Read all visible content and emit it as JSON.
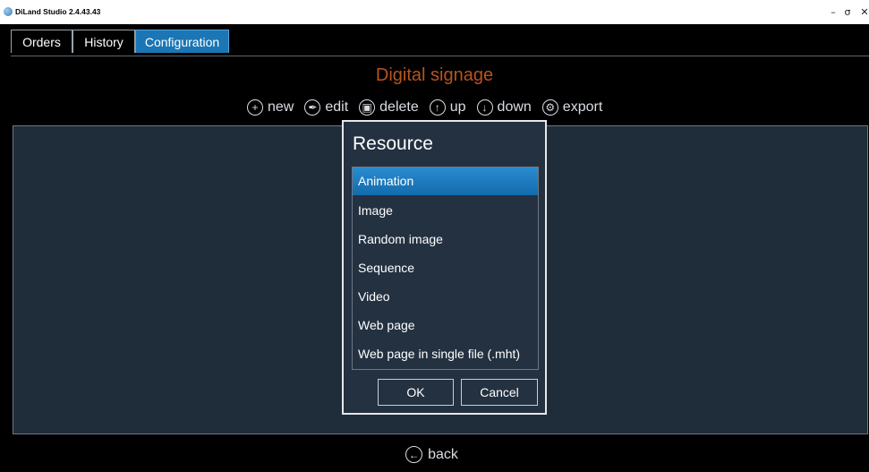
{
  "window": {
    "title": "DiLand Studio 2.4.43.43",
    "minimize": "–",
    "maximize": "σ",
    "close": "✕"
  },
  "tabs": [
    {
      "label": "Orders",
      "active": false
    },
    {
      "label": "History",
      "active": false
    },
    {
      "label": "Configuration",
      "active": true
    }
  ],
  "page": {
    "title": "Digital signage"
  },
  "toolbar": [
    {
      "label": "new",
      "icon": "plus-circle-icon",
      "glyph": "+"
    },
    {
      "label": "edit",
      "icon": "pencil-circle-icon",
      "glyph": "✒"
    },
    {
      "label": "delete",
      "icon": "trash-circle-icon",
      "glyph": "▣"
    },
    {
      "label": "up",
      "icon": "arrow-up-circle-icon",
      "glyph": "↑"
    },
    {
      "label": "down",
      "icon": "arrow-down-circle-icon",
      "glyph": "↓"
    },
    {
      "label": "export",
      "icon": "gear-circle-icon",
      "glyph": "⚙"
    }
  ],
  "dialog": {
    "title": "Resource",
    "items": [
      "Animation",
      "Image",
      "Random image",
      "Sequence",
      "Video",
      "Web page",
      "Web page in single file (.mht)"
    ],
    "selected_index": 0,
    "ok_label": "OK",
    "cancel_label": "Cancel"
  },
  "footer": {
    "back_label": "back",
    "back_icon": "arrow-left-circle-icon",
    "back_glyph": "←"
  },
  "colors": {
    "accent": "#1a76b4",
    "title_orange": "#b8541e",
    "panel": "#1f2c3a"
  }
}
